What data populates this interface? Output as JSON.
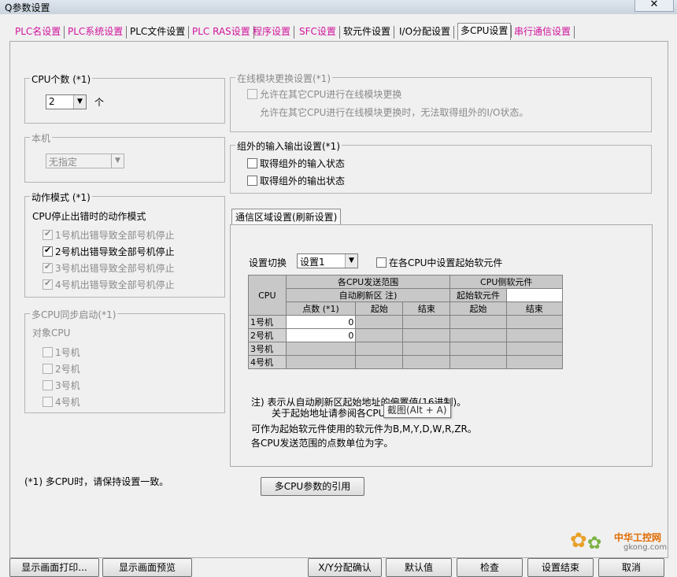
{
  "window": {
    "title": "Q参数设置",
    "close": "✕"
  },
  "tabs": [
    {
      "label": "PLC名设置",
      "pink": true
    },
    {
      "label": "PLC系统设置",
      "pink": true
    },
    {
      "label": "PLC文件设置",
      "pink": false
    },
    {
      "label": "PLC RAS设置",
      "pink": true
    },
    {
      "label": "程序设置",
      "pink": true
    },
    {
      "label": "SFC设置",
      "pink": true
    },
    {
      "label": "软元件设置",
      "pink": false
    },
    {
      "label": "I/O分配设置",
      "pink": false
    },
    {
      "label": "多CPU设置",
      "pink": false,
      "active": true
    },
    {
      "label": "串行通信设置",
      "pink": true
    }
  ],
  "cpu_count": {
    "legend": "CPU个数 (*1)",
    "value": "2",
    "unit": "个"
  },
  "this_machine": {
    "legend": "本机",
    "value": "无指定"
  },
  "action_mode": {
    "legend": "动作模式 (*1)",
    "subtitle": "CPU停止出错时的动作模式",
    "items": [
      {
        "label": "1号机出错导致全部号机停止",
        "checked": true,
        "enabled": false
      },
      {
        "label": "2号机出错导致全部号机停止",
        "checked": true,
        "enabled": true
      },
      {
        "label": "3号机出错导致全部号机停止",
        "checked": true,
        "enabled": false
      },
      {
        "label": "4号机出错导致全部号机停止",
        "checked": true,
        "enabled": false
      }
    ]
  },
  "sync_start": {
    "legend": "多CPU同步启动(*1)",
    "target_label": "对象CPU",
    "items": [
      "1号机",
      "2号机",
      "3号机",
      "4号机"
    ]
  },
  "footnote": "(*1) 多CPU时，请保持设置一致。",
  "online_module": {
    "legend": "在线模块更换设置(*1)",
    "checkbox": "允许在其它CPU进行在线模块更换",
    "desc": "允许在其它CPU进行在线模块更换时，无法取得组外的I/O状态。"
  },
  "outgroup_io": {
    "legend": "组外的输入输出设置(*1)",
    "input": "取得组外的输入状态",
    "output": "取得组外的输出状态"
  },
  "comm_area": {
    "tab": "通信区域设置(刷新设置)",
    "switch_label": "设置切换",
    "switch_value": "设置1",
    "start_dev_checkbox": "在各CPU中设置起始软元件",
    "table": {
      "cpu_header": "CPU",
      "send_range": "各CPU发送范围",
      "auto_refresh": "自动刷新区 注)",
      "cpu_device": "CPU侧软元件",
      "start_device": "起始软元件",
      "points": "点数 (*1)",
      "start": "起始",
      "end": "结束",
      "rows": [
        {
          "name": "1号机",
          "points": "0"
        },
        {
          "name": "2号机",
          "points": "0"
        },
        {
          "name": "3号机",
          "points": ""
        },
        {
          "name": "4号机",
          "points": ""
        }
      ]
    },
    "note1": "注)  表示从自动刷新区起始地址的偏置值(16进制)。",
    "note2": "关于起始地址请参阅各CPU",
    "note3": "可作为起始软元件使用的软元件为B,M,Y,D,W,R,ZR。",
    "note4": "各CPU发送范围的点数单位为字。",
    "tooltip": "截图(Alt + A)"
  },
  "multi_cpu_ref_button": "多CPU参数的引用",
  "bottom_buttons": {
    "print": "显示画面打印...",
    "preview": "显示画面预览",
    "xy_confirm": "X/Y分配确认",
    "default": "默认值",
    "check": "检查",
    "finish": "设置结束",
    "cancel": "取消"
  },
  "watermark": {
    "text1": "中华工控网",
    "text2": "gkong.com"
  }
}
